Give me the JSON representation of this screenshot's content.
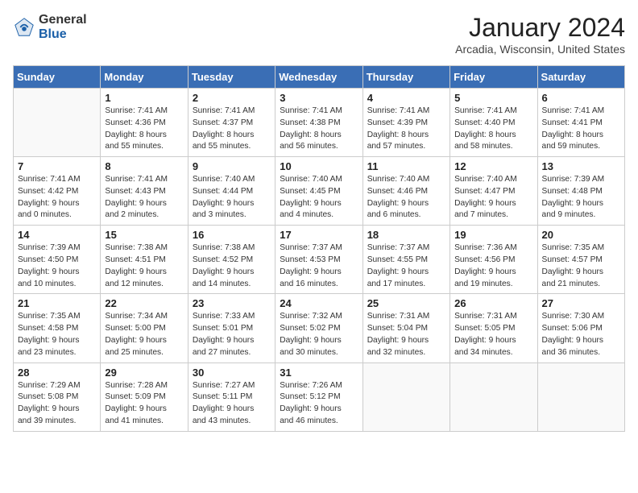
{
  "header": {
    "logo_general": "General",
    "logo_blue": "Blue",
    "title": "January 2024",
    "location": "Arcadia, Wisconsin, United States"
  },
  "days_of_week": [
    "Sunday",
    "Monday",
    "Tuesday",
    "Wednesday",
    "Thursday",
    "Friday",
    "Saturday"
  ],
  "weeks": [
    [
      {
        "day": "",
        "lines": []
      },
      {
        "day": "1",
        "lines": [
          "Sunrise: 7:41 AM",
          "Sunset: 4:36 PM",
          "Daylight: 8 hours",
          "and 55 minutes."
        ]
      },
      {
        "day": "2",
        "lines": [
          "Sunrise: 7:41 AM",
          "Sunset: 4:37 PM",
          "Daylight: 8 hours",
          "and 55 minutes."
        ]
      },
      {
        "day": "3",
        "lines": [
          "Sunrise: 7:41 AM",
          "Sunset: 4:38 PM",
          "Daylight: 8 hours",
          "and 56 minutes."
        ]
      },
      {
        "day": "4",
        "lines": [
          "Sunrise: 7:41 AM",
          "Sunset: 4:39 PM",
          "Daylight: 8 hours",
          "and 57 minutes."
        ]
      },
      {
        "day": "5",
        "lines": [
          "Sunrise: 7:41 AM",
          "Sunset: 4:40 PM",
          "Daylight: 8 hours",
          "and 58 minutes."
        ]
      },
      {
        "day": "6",
        "lines": [
          "Sunrise: 7:41 AM",
          "Sunset: 4:41 PM",
          "Daylight: 8 hours",
          "and 59 minutes."
        ]
      }
    ],
    [
      {
        "day": "7",
        "lines": [
          "Sunrise: 7:41 AM",
          "Sunset: 4:42 PM",
          "Daylight: 9 hours",
          "and 0 minutes."
        ]
      },
      {
        "day": "8",
        "lines": [
          "Sunrise: 7:41 AM",
          "Sunset: 4:43 PM",
          "Daylight: 9 hours",
          "and 2 minutes."
        ]
      },
      {
        "day": "9",
        "lines": [
          "Sunrise: 7:40 AM",
          "Sunset: 4:44 PM",
          "Daylight: 9 hours",
          "and 3 minutes."
        ]
      },
      {
        "day": "10",
        "lines": [
          "Sunrise: 7:40 AM",
          "Sunset: 4:45 PM",
          "Daylight: 9 hours",
          "and 4 minutes."
        ]
      },
      {
        "day": "11",
        "lines": [
          "Sunrise: 7:40 AM",
          "Sunset: 4:46 PM",
          "Daylight: 9 hours",
          "and 6 minutes."
        ]
      },
      {
        "day": "12",
        "lines": [
          "Sunrise: 7:40 AM",
          "Sunset: 4:47 PM",
          "Daylight: 9 hours",
          "and 7 minutes."
        ]
      },
      {
        "day": "13",
        "lines": [
          "Sunrise: 7:39 AM",
          "Sunset: 4:48 PM",
          "Daylight: 9 hours",
          "and 9 minutes."
        ]
      }
    ],
    [
      {
        "day": "14",
        "lines": [
          "Sunrise: 7:39 AM",
          "Sunset: 4:50 PM",
          "Daylight: 9 hours",
          "and 10 minutes."
        ]
      },
      {
        "day": "15",
        "lines": [
          "Sunrise: 7:38 AM",
          "Sunset: 4:51 PM",
          "Daylight: 9 hours",
          "and 12 minutes."
        ]
      },
      {
        "day": "16",
        "lines": [
          "Sunrise: 7:38 AM",
          "Sunset: 4:52 PM",
          "Daylight: 9 hours",
          "and 14 minutes."
        ]
      },
      {
        "day": "17",
        "lines": [
          "Sunrise: 7:37 AM",
          "Sunset: 4:53 PM",
          "Daylight: 9 hours",
          "and 16 minutes."
        ]
      },
      {
        "day": "18",
        "lines": [
          "Sunrise: 7:37 AM",
          "Sunset: 4:55 PM",
          "Daylight: 9 hours",
          "and 17 minutes."
        ]
      },
      {
        "day": "19",
        "lines": [
          "Sunrise: 7:36 AM",
          "Sunset: 4:56 PM",
          "Daylight: 9 hours",
          "and 19 minutes."
        ]
      },
      {
        "day": "20",
        "lines": [
          "Sunrise: 7:35 AM",
          "Sunset: 4:57 PM",
          "Daylight: 9 hours",
          "and 21 minutes."
        ]
      }
    ],
    [
      {
        "day": "21",
        "lines": [
          "Sunrise: 7:35 AM",
          "Sunset: 4:58 PM",
          "Daylight: 9 hours",
          "and 23 minutes."
        ]
      },
      {
        "day": "22",
        "lines": [
          "Sunrise: 7:34 AM",
          "Sunset: 5:00 PM",
          "Daylight: 9 hours",
          "and 25 minutes."
        ]
      },
      {
        "day": "23",
        "lines": [
          "Sunrise: 7:33 AM",
          "Sunset: 5:01 PM",
          "Daylight: 9 hours",
          "and 27 minutes."
        ]
      },
      {
        "day": "24",
        "lines": [
          "Sunrise: 7:32 AM",
          "Sunset: 5:02 PM",
          "Daylight: 9 hours",
          "and 30 minutes."
        ]
      },
      {
        "day": "25",
        "lines": [
          "Sunrise: 7:31 AM",
          "Sunset: 5:04 PM",
          "Daylight: 9 hours",
          "and 32 minutes."
        ]
      },
      {
        "day": "26",
        "lines": [
          "Sunrise: 7:31 AM",
          "Sunset: 5:05 PM",
          "Daylight: 9 hours",
          "and 34 minutes."
        ]
      },
      {
        "day": "27",
        "lines": [
          "Sunrise: 7:30 AM",
          "Sunset: 5:06 PM",
          "Daylight: 9 hours",
          "and 36 minutes."
        ]
      }
    ],
    [
      {
        "day": "28",
        "lines": [
          "Sunrise: 7:29 AM",
          "Sunset: 5:08 PM",
          "Daylight: 9 hours",
          "and 39 minutes."
        ]
      },
      {
        "day": "29",
        "lines": [
          "Sunrise: 7:28 AM",
          "Sunset: 5:09 PM",
          "Daylight: 9 hours",
          "and 41 minutes."
        ]
      },
      {
        "day": "30",
        "lines": [
          "Sunrise: 7:27 AM",
          "Sunset: 5:11 PM",
          "Daylight: 9 hours",
          "and 43 minutes."
        ]
      },
      {
        "day": "31",
        "lines": [
          "Sunrise: 7:26 AM",
          "Sunset: 5:12 PM",
          "Daylight: 9 hours",
          "and 46 minutes."
        ]
      },
      {
        "day": "",
        "lines": []
      },
      {
        "day": "",
        "lines": []
      },
      {
        "day": "",
        "lines": []
      }
    ]
  ]
}
